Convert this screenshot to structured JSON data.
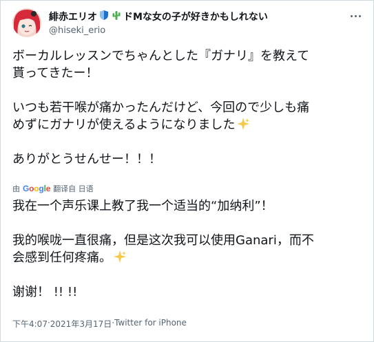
{
  "user": {
    "display_name_prefix": "緋赤エリオ",
    "display_name_suffix": "ドMな女の子が好きかもしれない",
    "handle": "@hiseki_erio",
    "avatar_icon": "anime-girl-avatar",
    "badge_icons": [
      "shield-emoji-icon",
      "cactus-emoji-icon"
    ]
  },
  "more_icon": "more-dots-icon",
  "tweet": {
    "ja_paragraphs": [
      [
        "ボーカルレッスンでちゃんとした『ガナリ』を教えて",
        "貰ってきたー！"
      ],
      [
        "いつも若干喉が痛かったんだけど、今回ので少しも痛",
        "めずにガナリが使えるようになりました"
      ],
      [
        "ありがとうせんせー！！！"
      ]
    ],
    "translate_prefix": "由",
    "translate_brand": "Google",
    "translate_action": "翻译自 日语",
    "zh_paragraphs": [
      [
        "我在一个声乐课上教了我一个适当的“加纳利”！"
      ],
      [
        "我的喉咙一直很痛，但是这次我可以使用Ganari，而不",
        "会感到任何疼痛。"
      ],
      [
        "谢谢！ !! !!"
      ]
    ]
  },
  "footer": {
    "time": "下午4:07",
    "separator": " · ",
    "date": "2021年3月17日",
    "source": "Twitter for iPhone"
  },
  "colors": {
    "text": "#0f1419",
    "muted": "#536471",
    "border": "#cfd9de",
    "sparkle": "#f7c948"
  }
}
